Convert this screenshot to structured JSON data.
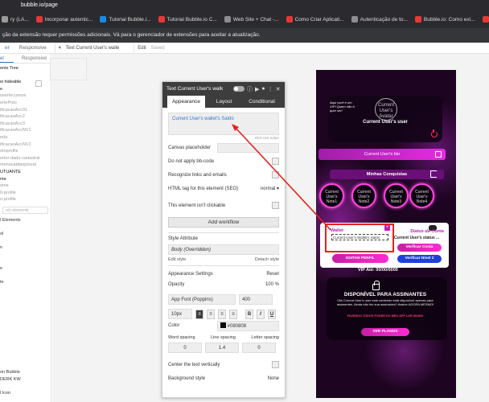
{
  "browser": {
    "address": "bubble.io/page",
    "bookmarks": [
      {
        "label": "ry (LA...",
        "color": "#9b9b9b"
      },
      {
        "label": "Incorporar autentic...",
        "color": "#e53935"
      },
      {
        "label": "Tutorial Bubble.i...",
        "color": "#1e88e5"
      },
      {
        "label": "Tutorial Bubble.io C...",
        "color": "#e53935"
      },
      {
        "label": "Web Site + Chat -...",
        "color": "#8e8e8e"
      },
      {
        "label": "Como Criar Aplicati...",
        "color": "#e53935"
      },
      {
        "label": "Autenticação de to...",
        "color": "#8e8e8e"
      },
      {
        "label": "Bubble.io: Como exi...",
        "color": "#e53935"
      },
      {
        "label": "Como criar cobran",
        "color": "#e53935"
      }
    ],
    "extension_notice": "ção da extensão requer permissões adicionais. Vá para o gerenciador de extensões para aceitar a atualização."
  },
  "editor": {
    "tabs": [
      "er",
      "Responsive"
    ],
    "element_name": "Text Current User's walle",
    "edit_label": "Edit",
    "saved_label": "Saved"
  },
  "left_panel": {
    "lines": [
      {
        "text": "ents Tree",
        "style": "bold"
      },
      {
        "text": "",
        "style": "muted"
      },
      {
        "text": "w hideable",
        "style": "bold"
      },
      {
        "text": "e",
        "style": "bold"
      },
      {
        "text": "usertecussos",
        "style": "muted"
      },
      {
        "text": "ertePoto",
        "style": "muted"
      },
      {
        "text": "ificacaoAcc01",
        "style": "muted"
      },
      {
        "text": "ificacaoAcc2",
        "style": "muted"
      },
      {
        "text": "ificacaoAcc3",
        "style": "muted"
      },
      {
        "text": "ificacaoAccNV1",
        "style": "muted"
      },
      {
        "text": "eda",
        "style": "muted"
      },
      {
        "text": "ificacaoAccNV2",
        "style": "muted"
      },
      {
        "text": "otoprofile",
        "style": "muted"
      },
      {
        "text": "ertor-dado-cadastral",
        "style": "muted"
      },
      {
        "text": "menacatdaoptoval",
        "style": "muted"
      },
      {
        "text": "UTUANTE",
        "style": "bold"
      },
      {
        "text": "me",
        "style": "bold"
      },
      {
        "text": "ome",
        "style": "muted"
      },
      {
        "text": "0-profile",
        "style": "muted"
      },
      {
        "text": "o-profile",
        "style": "muted"
      }
    ],
    "search_placeholder": "rch elements",
    "lower_items": [
      "l Elements",
      "",
      "ol",
      "",
      "n",
      "",
      "",
      "e",
      "",
      "te",
      "",
      "",
      "",
      "",
      "",
      "",
      "",
      "",
      "",
      "",
      "",
      "",
      "on Bubble",
      "DERK KW",
      "",
      "l Icon"
    ]
  },
  "property_editor": {
    "title": "Text Current User's walk",
    "tabs": [
      "Appearance",
      "Layout",
      "Conditional"
    ],
    "text_value": "Current User's wallet's Saldo",
    "rich_text_hint": "Rich text editor",
    "canvas_placeholder_label": "Canvas placeholder",
    "no_bbcode_label": "Do not apply bb-code",
    "recognize_links_label": "Recognize links and emails",
    "html_tag_label": "HTML tag for this element (SEO)",
    "html_tag_value": "normal",
    "not_clickable_label": "This element isn't clickable",
    "add_workflow_label": "Add workflow",
    "style_attribute_label": "Style Attribute",
    "style_value": "Body (Overridden)",
    "edit_style_label": "Edit style",
    "detach_style_label": "Detach style",
    "appearance_settings_label": "Appearance Settings",
    "reset_label": "Reset",
    "opacity_label": "Opacity",
    "opacity_value": "100",
    "opacity_unit": "%",
    "font_value": "App Font (Poppins)",
    "font_weight": "400",
    "font_size": "10px",
    "color_label": "Color",
    "color_value": "#080808",
    "word_spacing_label": "Word spacing",
    "line_spacing_label": "Line spacing",
    "letter_spacing_label": "Letter spacing",
    "word_spacing_value": "0",
    "line_spacing_value": "1.4",
    "letter_spacing_value": "0",
    "center_vertically_label": "Center the text vertically",
    "background_style_label": "Background style",
    "background_style_value": "None"
  },
  "preview": {
    "logo_text": "Aqui você é um VIP! Quem não é, quer ser!",
    "avatar_text": "Current User's Avatar",
    "user_label": "Current User's user",
    "bio_label": "Current User's bio",
    "conquests_label": "Minhas Conquistas",
    "badges": [
      "Current User's Note1",
      "Current User's Note2",
      "Current User's Note3",
      "Current User's Note4"
    ],
    "wallet_title": "Wallet",
    "wallet_text": "Current User's Wallet's Saldo",
    "status_title": "Status da Conta",
    "status_text": "Current User's status ...",
    "verify_label": "Verificar Conta",
    "level_label": "Verificar Nível 2",
    "edit_profile_label": "EDITAR PERFIL",
    "vip_label": "VIP Até: 00/00/0000",
    "locked_title": "DISPONÍVEL PARA ASSINANTES",
    "locked_desc": "Olá Current User's user este conteúdo está disponível apenas para assinantes. Ainda não fez sua assinatura? Assine AGORA MESMO!",
    "locked_red": "FAZENDO TODOS PODER DO MEU APP LAR MUNDI",
    "plans_label": "VER PLANOS"
  },
  "colors": {
    "accent_blue": "#2f76d4",
    "highlight_red": "#e8201d",
    "brand_pink": "#c01bb8",
    "button_blue": "#1f3fdb"
  }
}
